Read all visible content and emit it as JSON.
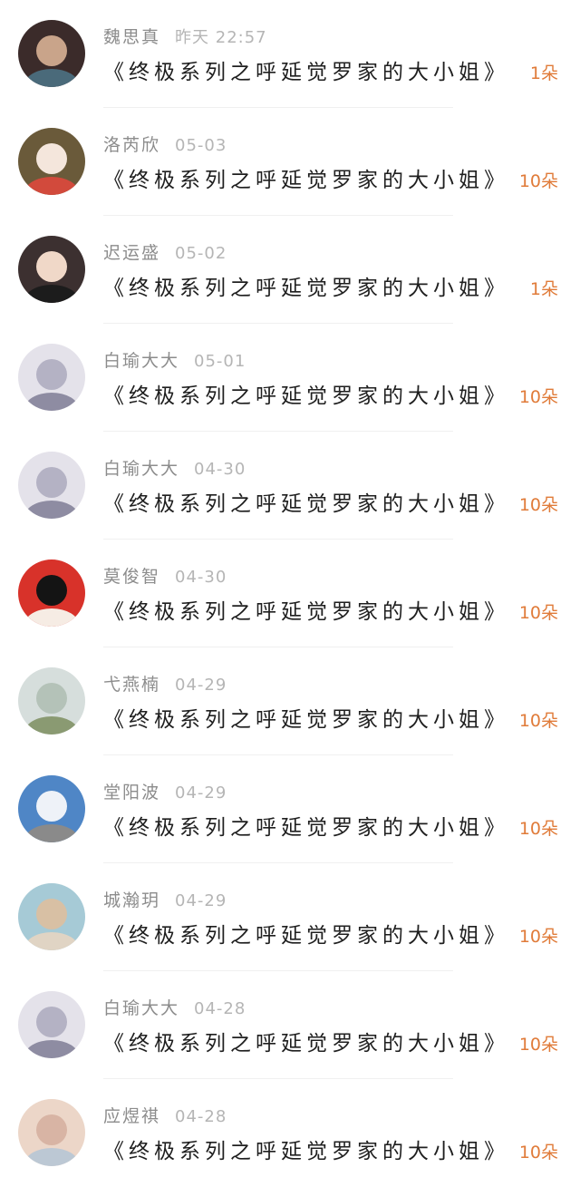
{
  "items": [
    {
      "name": "魏思真",
      "time": "昨天 22:57",
      "book": "《终极系列之呼延觉罗家的大小姐》",
      "flowers": "1朵",
      "avatar_colors": [
        "#3b2b2a",
        "#c9a48a",
        "#4a6a7a"
      ]
    },
    {
      "name": "洛芮欣",
      "time": "05-03",
      "book": "《终极系列之呼延觉罗家的大小姐》",
      "flowers": "10朵",
      "avatar_colors": [
        "#6a5a3a",
        "#f4e6dc",
        "#d24a3c"
      ]
    },
    {
      "name": "迟运盛",
      "time": "05-02",
      "book": "《终极系列之呼延觉罗家的大小姐》",
      "flowers": "1朵",
      "avatar_colors": [
        "#3c3030",
        "#f0d8c8",
        "#1c1c1c"
      ]
    },
    {
      "name": "白瑜大大",
      "time": "05-01",
      "book": "《终极系列之呼延觉罗家的大小姐》",
      "flowers": "10朵",
      "avatar_colors": [
        "#e4e2ea",
        "#b4b2c4",
        "#8e8ca2"
      ]
    },
    {
      "name": "白瑜大大",
      "time": "04-30",
      "book": "《终极系列之呼延觉罗家的大小姐》",
      "flowers": "10朵",
      "avatar_colors": [
        "#e4e2ea",
        "#b4b2c4",
        "#8e8ca2"
      ]
    },
    {
      "name": "莫俊智",
      "time": "04-30",
      "book": "《终极系列之呼延觉罗家的大小姐》",
      "flowers": "10朵",
      "avatar_colors": [
        "#d8322a",
        "#141414",
        "#f6ece4"
      ]
    },
    {
      "name": "弋燕楠",
      "time": "04-29",
      "book": "《终极系列之呼延觉罗家的大小姐》",
      "flowers": "10朵",
      "avatar_colors": [
        "#d6dedc",
        "#b4c2b8",
        "#8a9a72"
      ]
    },
    {
      "name": "堂阳波",
      "time": "04-29",
      "book": "《终极系列之呼延觉罗家的大小姐》",
      "flowers": "10朵",
      "avatar_colors": [
        "#4f86c6",
        "#eef2f8",
        "#8a8a8a"
      ]
    },
    {
      "name": "城瀚玥",
      "time": "04-29",
      "book": "《终极系列之呼延觉罗家的大小姐》",
      "flowers": "10朵",
      "avatar_colors": [
        "#a6cad6",
        "#d8c0a4",
        "#e0d4c4"
      ]
    },
    {
      "name": "白瑜大大",
      "time": "04-28",
      "book": "《终极系列之呼延觉罗家的大小姐》",
      "flowers": "10朵",
      "avatar_colors": [
        "#e4e2ea",
        "#b4b2c4",
        "#8e8ca2"
      ]
    },
    {
      "name": "应煜祺",
      "time": "04-28",
      "book": "《终极系列之呼延觉罗家的大小姐》",
      "flowers": "10朵",
      "avatar_colors": [
        "#ecd6c8",
        "#d8b4a4",
        "#bcc8d4"
      ]
    }
  ]
}
